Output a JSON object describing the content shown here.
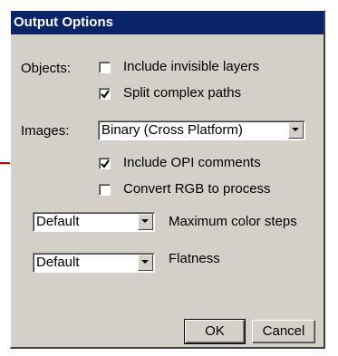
{
  "dialog": {
    "title": "Output Options"
  },
  "objects": {
    "label": "Objects:",
    "include_invisible_layers": {
      "label": "Include invisible layers",
      "checked": false
    },
    "split_complex_paths": {
      "label": "Split complex paths",
      "checked": true
    }
  },
  "images": {
    "label": "Images:",
    "format_selected": "Binary (Cross Platform)",
    "include_opi_comments": {
      "label": "Include OPI comments",
      "checked": true
    },
    "convert_rgb_to_process": {
      "label": "Convert RGB to process",
      "checked": false
    }
  },
  "max_color_steps": {
    "selected": "Default",
    "label": "Maximum color steps"
  },
  "flatness": {
    "selected": "Default",
    "label": "Flatness"
  },
  "buttons": {
    "ok_label": "OK",
    "cancel_label": "Cancel"
  },
  "colors": {
    "titlebar": "#0a246a",
    "dialog_face": "#d4d0c8",
    "annotation_arrow": "#d00000"
  },
  "annotation": {
    "icon": "arrow-right-icon"
  }
}
